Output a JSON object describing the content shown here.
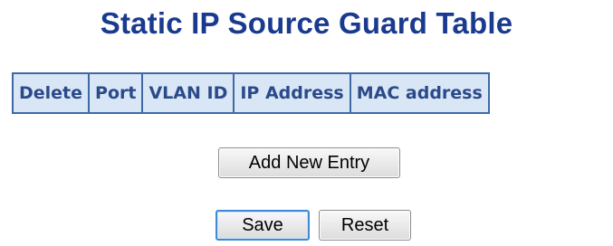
{
  "page": {
    "title": "Static IP Source Guard Table"
  },
  "table": {
    "columns": [
      "Delete",
      "Port",
      "VLAN ID",
      "IP Address",
      "MAC address"
    ],
    "rows": []
  },
  "buttons": {
    "add_new_entry": "Add New Entry",
    "save": "Save",
    "reset": "Reset"
  },
  "colors": {
    "title": "#1a3a8f",
    "header_bg": "#d9e6f5",
    "header_text": "#2a4a8a",
    "table_border": "#3d6aa6",
    "focus_border": "#3c8ad8"
  }
}
